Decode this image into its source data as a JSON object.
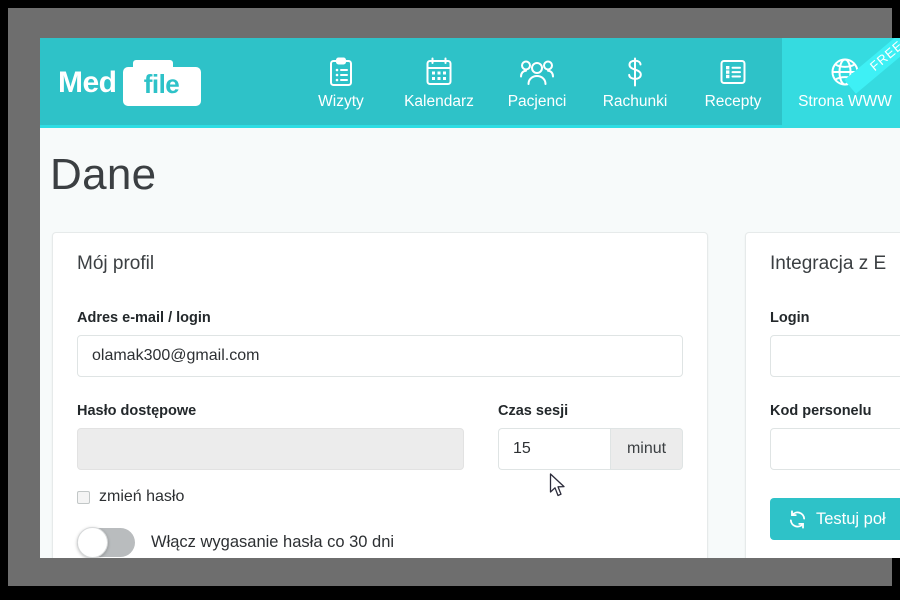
{
  "brand": {
    "word_med": "Med",
    "word_file": "file",
    "logo_icon": "folder-file-icon"
  },
  "nav": {
    "items": [
      {
        "label": "Wizyty",
        "icon": "clipboard-icon",
        "active": false,
        "badge": ""
      },
      {
        "label": "Kalendarz",
        "icon": "calendar-icon",
        "active": false,
        "badge": ""
      },
      {
        "label": "Pacjenci",
        "icon": "people-icon",
        "active": false,
        "badge": ""
      },
      {
        "label": "Rachunki",
        "icon": "dollar-icon",
        "active": false,
        "badge": ""
      },
      {
        "label": "Recepty",
        "icon": "list-icon",
        "active": false,
        "badge": ""
      },
      {
        "label": "Strona WWW",
        "icon": "globe-icon",
        "active": true,
        "badge": "FREE"
      }
    ]
  },
  "page": {
    "title": "Dane"
  },
  "profile_card": {
    "title": "Mój profil",
    "email_label": "Adres e-mail / login",
    "email_value": "olamak300@gmail.com",
    "password_label": "Hasło dostępowe",
    "password_value": "",
    "session_label": "Czas sesji",
    "session_value": "15",
    "session_unit": "minut",
    "change_password_label": "zmień hasło",
    "change_password_checked": false,
    "expire_toggle_label": "Włącz wygasanie hasła co 30 dni",
    "expire_toggle_on": false
  },
  "integration_card": {
    "title": "Integracja z E",
    "login_label": "Login",
    "login_value": "",
    "staff_code_label": "Kod personelu",
    "staff_code_value": "",
    "test_button_label": "Testuj poł",
    "test_button_icon": "refresh-icon"
  },
  "colors": {
    "nav_teal": "#2ec2c8",
    "nav_active_teal": "#35dbe0",
    "nav_underline": "#2ddde3",
    "ribbon_cyan": "#3ef0f5",
    "page_background": "#f7fafa",
    "frame_gray": "#6e6e6e",
    "text_dark": "#2d3033"
  }
}
